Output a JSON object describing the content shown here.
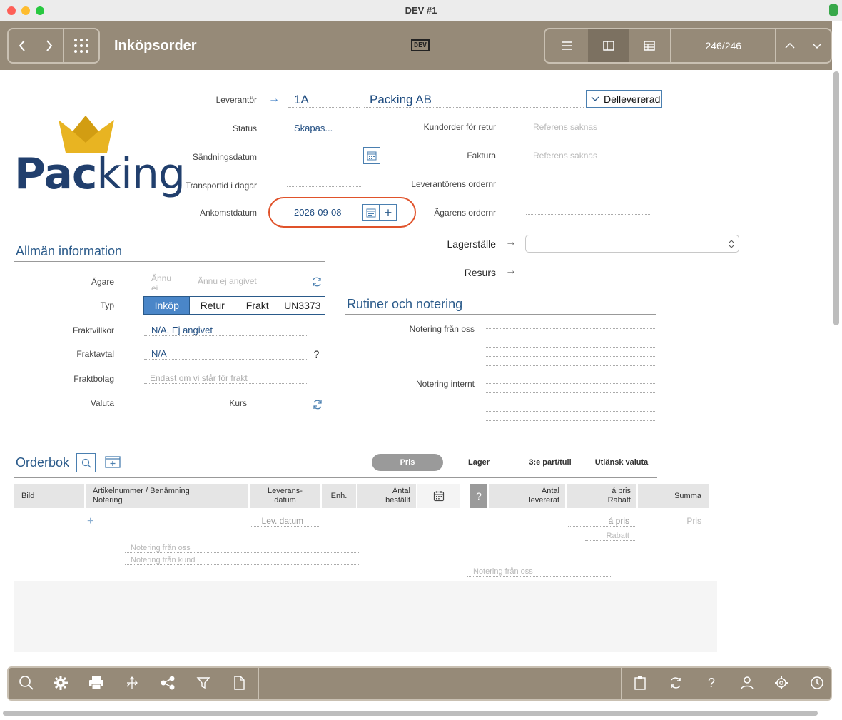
{
  "window": {
    "title": "DEV #1"
  },
  "toolbar": {
    "app_title": "Inköpsorder",
    "dev_badge": "DEV",
    "record_counter": "246/246"
  },
  "header": {
    "leverantor_label": "Leverantör",
    "leverantor_code": "1A",
    "leverantor_name": "Packing AB",
    "delivery_status": "Dellevererad",
    "status_label": "Status",
    "status_value": "Skapas...",
    "sandningsdatum_label": "Sändningsdatum",
    "transporttid_label": "Transportid i dagar",
    "ankomstdatum_label": "Ankomstdatum",
    "ankomstdatum_value": "2026-09-08",
    "kundorder_label": "Kundorder för retur",
    "kundorder_placeholder": "Referens saknas",
    "faktura_label": "Faktura",
    "faktura_placeholder": "Referens saknas",
    "leverantorens_ordernr_label": "Leverantörens ordernr",
    "agarens_ordernr_label": "Ägarens ordernr",
    "lagerstalle_label": "Lagerställe",
    "resurs_label": "Resurs"
  },
  "logo": {
    "text_pac": "Pac",
    "text_king": "king"
  },
  "allman": {
    "title": "Allmän information",
    "agare_label": "Ägare",
    "agare_placeholder_short": "Ännu ej",
    "agare_placeholder": "Ännu ej angivet",
    "typ_label": "Typ",
    "typ_options": [
      "Inköp",
      "Retur",
      "Frakt",
      "UN3373"
    ],
    "typ_selected": "Inköp",
    "fraktvillkor_label": "Fraktvillkor",
    "fraktvillkor_value": "N/A, Ej angivet",
    "fraktavtal_label": "Fraktavtal",
    "fraktavtal_value": "N/A",
    "fraktbolag_label": "Fraktbolag",
    "fraktbolag_placeholder": "Endast om vi står för frakt",
    "valuta_label": "Valuta",
    "kurs_label": "Kurs"
  },
  "rutiner": {
    "title": "Rutiner och notering",
    "notering_fran_oss_label": "Notering från oss",
    "notering_internt_label": "Notering internt"
  },
  "orderbok": {
    "title": "Orderbok",
    "tabs": [
      "Pris",
      "Lager",
      "3:e part/tull",
      "Utlänsk valuta"
    ],
    "active_tab": "Pris",
    "columns": {
      "bild": "Bild",
      "artikel_1": "Artikelnummer / Benämning",
      "artikel_2": "Notering",
      "leverans_1": "Leverans-",
      "leverans_2": "datum",
      "enh": "Enh.",
      "antal_1": "Antal",
      "antal_2": "beställt",
      "q": "?",
      "levererat_1": "Antal",
      "levererat_2": "levererat",
      "apris_1": "á pris",
      "apris_2": "Rabatt",
      "summa": "Summa"
    },
    "row_placeholders": {
      "lev_datum": "Lev. datum",
      "a_pris": "á pris",
      "rabatt": "Rabatt",
      "pris": "Pris",
      "notering_fran_oss": "Notering från oss",
      "notering_fran_kund": "Notering från kund",
      "notering_fran_oss_right": "Notering från oss"
    }
  },
  "colors": {
    "toolbar": "#968a78",
    "accent": "#4a86c8",
    "link": "#1f4c80",
    "highlight": "#e0522a"
  }
}
